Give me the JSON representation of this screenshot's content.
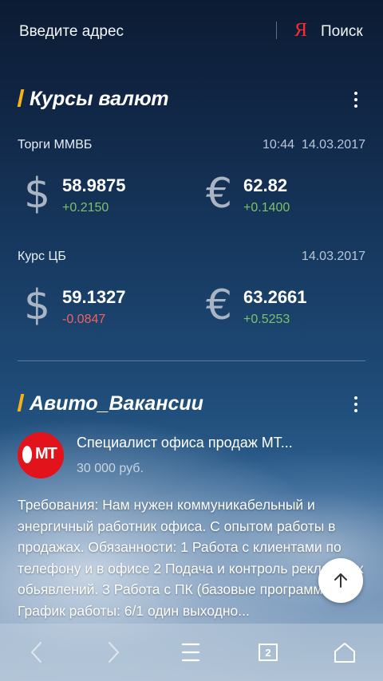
{
  "address_bar": {
    "placeholder": "Введите адрес",
    "search_logo": "Я",
    "search_label": "Поиск"
  },
  "currency": {
    "title": "Курсы валют",
    "moex": {
      "label": "Торги ММВБ",
      "time": "10:44",
      "date": "14.03.2017",
      "usd": {
        "symbol": "$",
        "value": "58.9875",
        "delta": "+0.2150",
        "direction": "up"
      },
      "eur": {
        "symbol": "€",
        "value": "62.82",
        "delta": "+0.1400",
        "direction": "up"
      }
    },
    "cbr": {
      "label": "Курс ЦБ",
      "date": "14.03.2017",
      "usd": {
        "symbol": "$",
        "value": "59.1327",
        "delta": "-0.0847",
        "direction": "down"
      },
      "eur": {
        "symbol": "€",
        "value": "63.2661",
        "delta": "+0.5253",
        "direction": "up"
      }
    }
  },
  "avito": {
    "title": "Авито_Вакансии",
    "job": {
      "logo_text": "МТ",
      "title": "Специалист офиса продаж МТ...",
      "salary": "30 000 руб.",
      "description": "Требования: Нам нужен коммуникабельный и энергичный работник офиса. С опытом работы в  продажах. Обязанности:  1 Работа с клиентами по телефону и в офисе 2 Подача и контроль рекламных обьявлений. 3 Работа с ПК (базовые программы) График работы: 6/1 один выходно..."
    }
  },
  "toolbar": {
    "tabs_count": "2",
    "icons": [
      "back-icon",
      "forward-icon",
      "menu-icon",
      "tabs-icon",
      "home-icon"
    ]
  },
  "colors": {
    "accent": "#f7b21a",
    "positive": "#7dc26a",
    "negative": "#f06262",
    "yandex_red": "#ff2d2d",
    "mts_red": "#e3131c"
  }
}
